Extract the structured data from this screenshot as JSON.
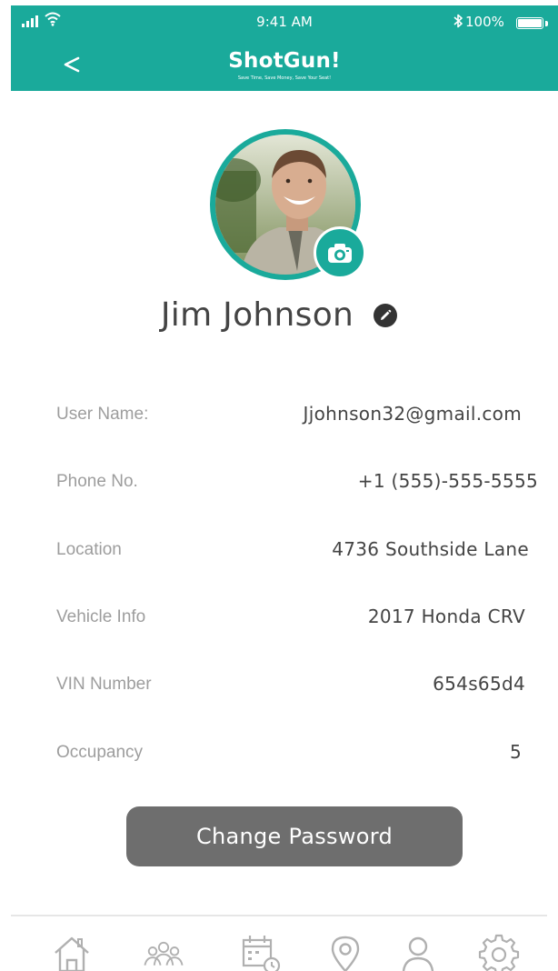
{
  "status_bar": {
    "time": "9:41 AM",
    "battery": "100%"
  },
  "header": {
    "logo_title": "ShotGun!",
    "logo_tagline": "Save Time, Save Money, Save Your Seat!",
    "back_label": "<"
  },
  "profile": {
    "name": "Jim Johnson"
  },
  "fields": [
    {
      "label": "User Name:",
      "value": "Jjohnson32@gmail.com"
    },
    {
      "label": "Phone No.",
      "value": "+1 (555)-555-5555"
    },
    {
      "label": "Location",
      "value": "4736 Southside Lane"
    },
    {
      "label": "Vehicle Info",
      "value": "2017 Honda CRV"
    },
    {
      "label": "VIN Number",
      "value": "654s65d4"
    },
    {
      "label": "Occupancy",
      "value": "5"
    }
  ],
  "actions": {
    "change_password": "Change Password"
  },
  "tab_bar": {
    "tabs": [
      "home-icon",
      "group-icon",
      "calendar-icon",
      "location-pin-icon",
      "profile-icon",
      "settings-icon"
    ]
  },
  "colors": {
    "brand": "#1aaa9b",
    "button": "#6e6e6e",
    "label": "#9d9d9d",
    "tab_icon": "#b0b0b0"
  }
}
